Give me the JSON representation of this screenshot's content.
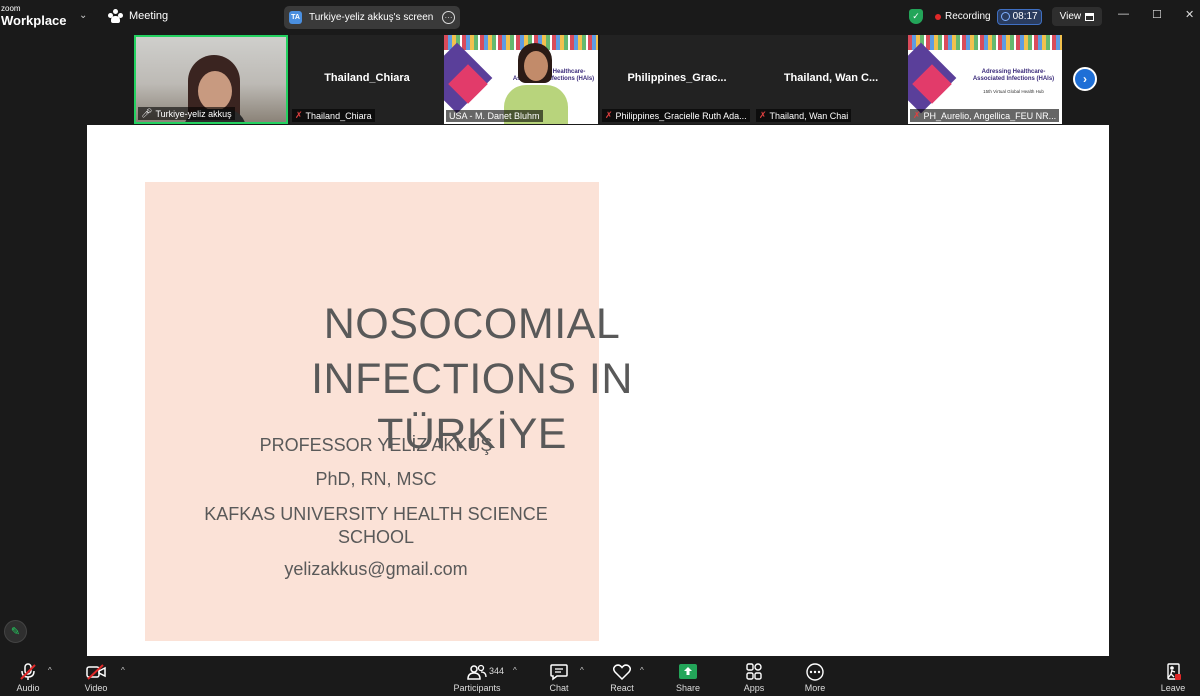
{
  "app": {
    "logo_top": "zoom",
    "logo_bottom": "Workplace"
  },
  "meeting": {
    "label": "Meeting"
  },
  "share_pill": {
    "badge": "TA",
    "label": "Turkiye-yeliz akkuş's screen"
  },
  "status": {
    "recording": "Recording",
    "timer": "08:17",
    "view": "View"
  },
  "gallery": [
    {
      "name": "Turkiye-yeliz akkuş",
      "display_name": "",
      "muted": true,
      "kind": "video"
    },
    {
      "name": "Thailand_Chiara",
      "display_name": "Thailand_Chiara",
      "muted": true,
      "kind": "name"
    },
    {
      "name": "USA - M. Danet Bluhm",
      "display_name": "",
      "muted": false,
      "kind": "slide-video"
    },
    {
      "name": "Philippines_Gracielle Ruth Ada...",
      "display_name": "Philippines_Grac...",
      "muted": true,
      "kind": "name"
    },
    {
      "name": "Thailand, Wan Chai",
      "display_name": "Thailand,  Wan C...",
      "muted": true,
      "kind": "name"
    },
    {
      "name": "PH_Aurelio, Angellica_FEU NR...",
      "display_name": "",
      "muted": true,
      "kind": "slide"
    }
  ],
  "thumb_slide": {
    "title": "Adressing Healthcare-Associated Infections (HAIs)",
    "sub1": "15th Virtual Global Health Hub",
    "short_title": "Adressing Healthcare-\nAssociated Infections (HAIs)",
    "short_sub": "15th Virtual Global Health Hub"
  },
  "slide": {
    "title_line1": "NOSOCOMIAL",
    "title_line2": "INFECTIONS IN TÜRKİYE",
    "presenter": "PROFESSOR YELİZ AKKUŞ",
    "credentials": "PhD, RN, MSC",
    "affiliation_line1": "KAFKAS UNIVERSITY HEALTH SCIENCE",
    "affiliation_line2": "SCHOOL",
    "email": "yelizakkus@gmail.com"
  },
  "toolbar": {
    "audio": "Audio",
    "video": "Video",
    "participants": "Participants",
    "participant_count": "344",
    "chat": "Chat",
    "react": "React",
    "share": "Share",
    "apps": "Apps",
    "more": "More",
    "leave": "Leave"
  },
  "colors": {
    "accent_green": "#23d160",
    "share_green": "#23a559",
    "arrow_blue": "#1f6fd6",
    "leave_red": "#e02828",
    "slide_pink": "#fbe2d7"
  }
}
